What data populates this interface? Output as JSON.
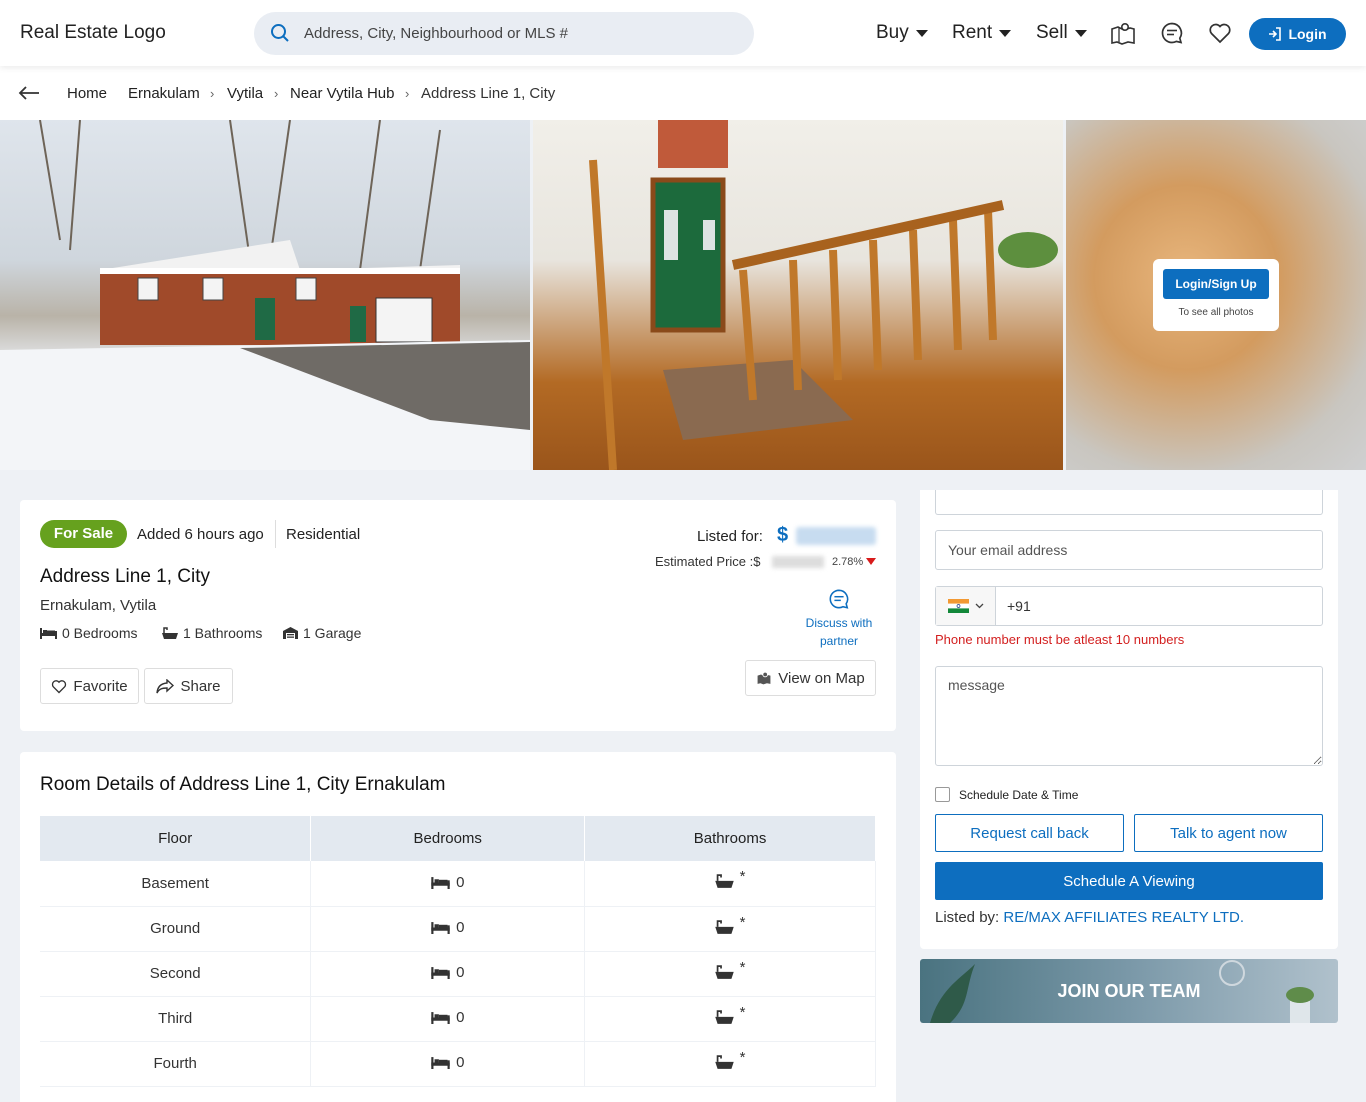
{
  "header": {
    "logo": "Real Estate Logo",
    "search_placeholder": "Address, City, Neighbourhood or MLS #",
    "nav": [
      "Buy",
      "Rent",
      "Sell"
    ],
    "login_label": "Login",
    "accent": "#0d6ebf"
  },
  "breadcrumb": [
    "Home",
    "Ernakulam",
    "Vytila",
    "Near Vytila Hub",
    "Address Line 1, City"
  ],
  "gallery": {
    "login_button": "Login/Sign Up",
    "login_sub": "To see all photos"
  },
  "listing": {
    "status": "For Sale",
    "added": "Added 6 hours ago",
    "type": "Residential",
    "title": "Address Line 1, City",
    "location": "Ernakulam, Vytila",
    "features": [
      "0 Bedrooms",
      "1 Bathrooms",
      "1 Garage"
    ],
    "favorite_label": "Favorite",
    "share_label": "Share",
    "listed_for_label": "Listed for:",
    "currency": "$",
    "estimated_label": "Estimated Price :$",
    "change_pct": "2.78%",
    "discuss_label": "Discuss with partner",
    "map_label": "View on Map",
    "status_color": "#66a11e"
  },
  "rooms": {
    "title": "Room Details of Address Line 1, City Ernakulam",
    "headers": [
      "Floor",
      "Bedrooms",
      "Bathrooms"
    ],
    "rows": [
      {
        "floor": "Basement",
        "bedrooms": "0",
        "bathrooms": "*"
      },
      {
        "floor": "Ground",
        "bedrooms": "0",
        "bathrooms": "*"
      },
      {
        "floor": "Second",
        "bedrooms": "0",
        "bathrooms": "*"
      },
      {
        "floor": "Third",
        "bedrooms": "0",
        "bathrooms": "*"
      },
      {
        "floor": "Fourth",
        "bedrooms": "0",
        "bathrooms": "*"
      }
    ]
  },
  "contact": {
    "email_placeholder": "Your email address",
    "phone_code": "+91",
    "phone_error": "Phone number must be atleast 10 numbers",
    "message_placeholder": "message",
    "schedule_label": "Schedule Date & Time",
    "callback_label": "Request call back",
    "talk_label": "Talk to agent now",
    "schedule_button": "Schedule A Viewing",
    "listed_by_label": "Listed by:",
    "listed_by_value": "RE/MAX AFFILIATES REALTY LTD.",
    "error_color": "#d32020"
  },
  "banner": {
    "label": "JOIN OUR TEAM"
  }
}
